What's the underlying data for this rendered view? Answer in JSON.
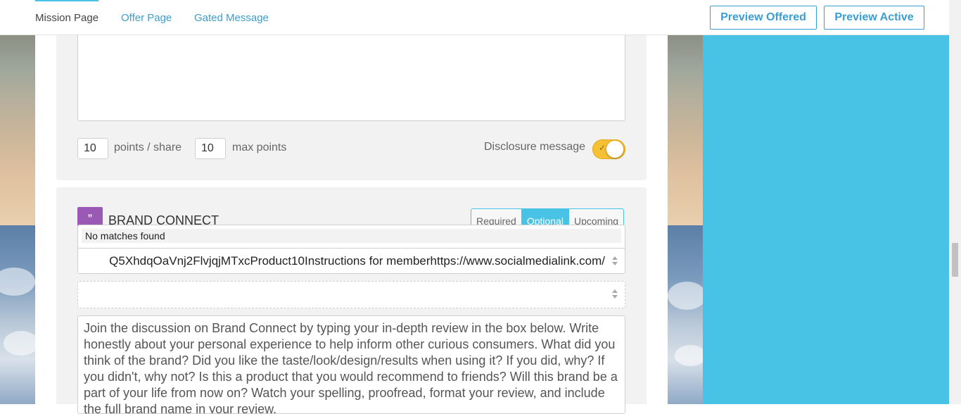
{
  "nav": {
    "tabs": [
      {
        "label": "Mission Page",
        "active": true
      },
      {
        "label": "Offer Page",
        "active": false
      },
      {
        "label": "Gated Message",
        "active": false
      }
    ],
    "preview_offered": "Preview Offered",
    "preview_active": "Preview Active"
  },
  "share_settings": {
    "points_per_share_value": "10",
    "points_per_share_label": "points / share",
    "max_points_value": "10",
    "max_points_label": "max points",
    "disclosure_label": "Disclosure message",
    "disclosure_enabled": true
  },
  "brand_connect": {
    "title": "BRAND CONNECT",
    "icon": "quote-icon",
    "icon_glyph": "”",
    "segments": [
      {
        "label": "Required",
        "selected": false
      },
      {
        "label": "Optional",
        "selected": true
      },
      {
        "label": "Upcoming",
        "selected": false
      }
    ],
    "dropdown_message": "No matches found",
    "selected_value": "Q5XhdqOaVnj2FlvjqjMTxcProduct10Instructions for memberhttps://www.socialmedialink.com/",
    "instructions_text": "Join the discussion on Brand Connect by typing your in-depth review in the box below. Write honestly about your personal experience to help inform other curious consumers. What did you think of the brand? Did you like the taste/look/design/results when using it? If you did, why? If you didn't, why not? Is this a product that you would recommend to friends? Will this brand be a part of your life from now on? Watch your spelling, proofread, format your review, and include the full brand name in your review."
  },
  "colors": {
    "accent": "#48c3e6",
    "link": "#3a9fd0",
    "toggle_on": "#f5c034",
    "brand_icon": "#9b59b6",
    "panel_bg": "#f2f2f2"
  }
}
